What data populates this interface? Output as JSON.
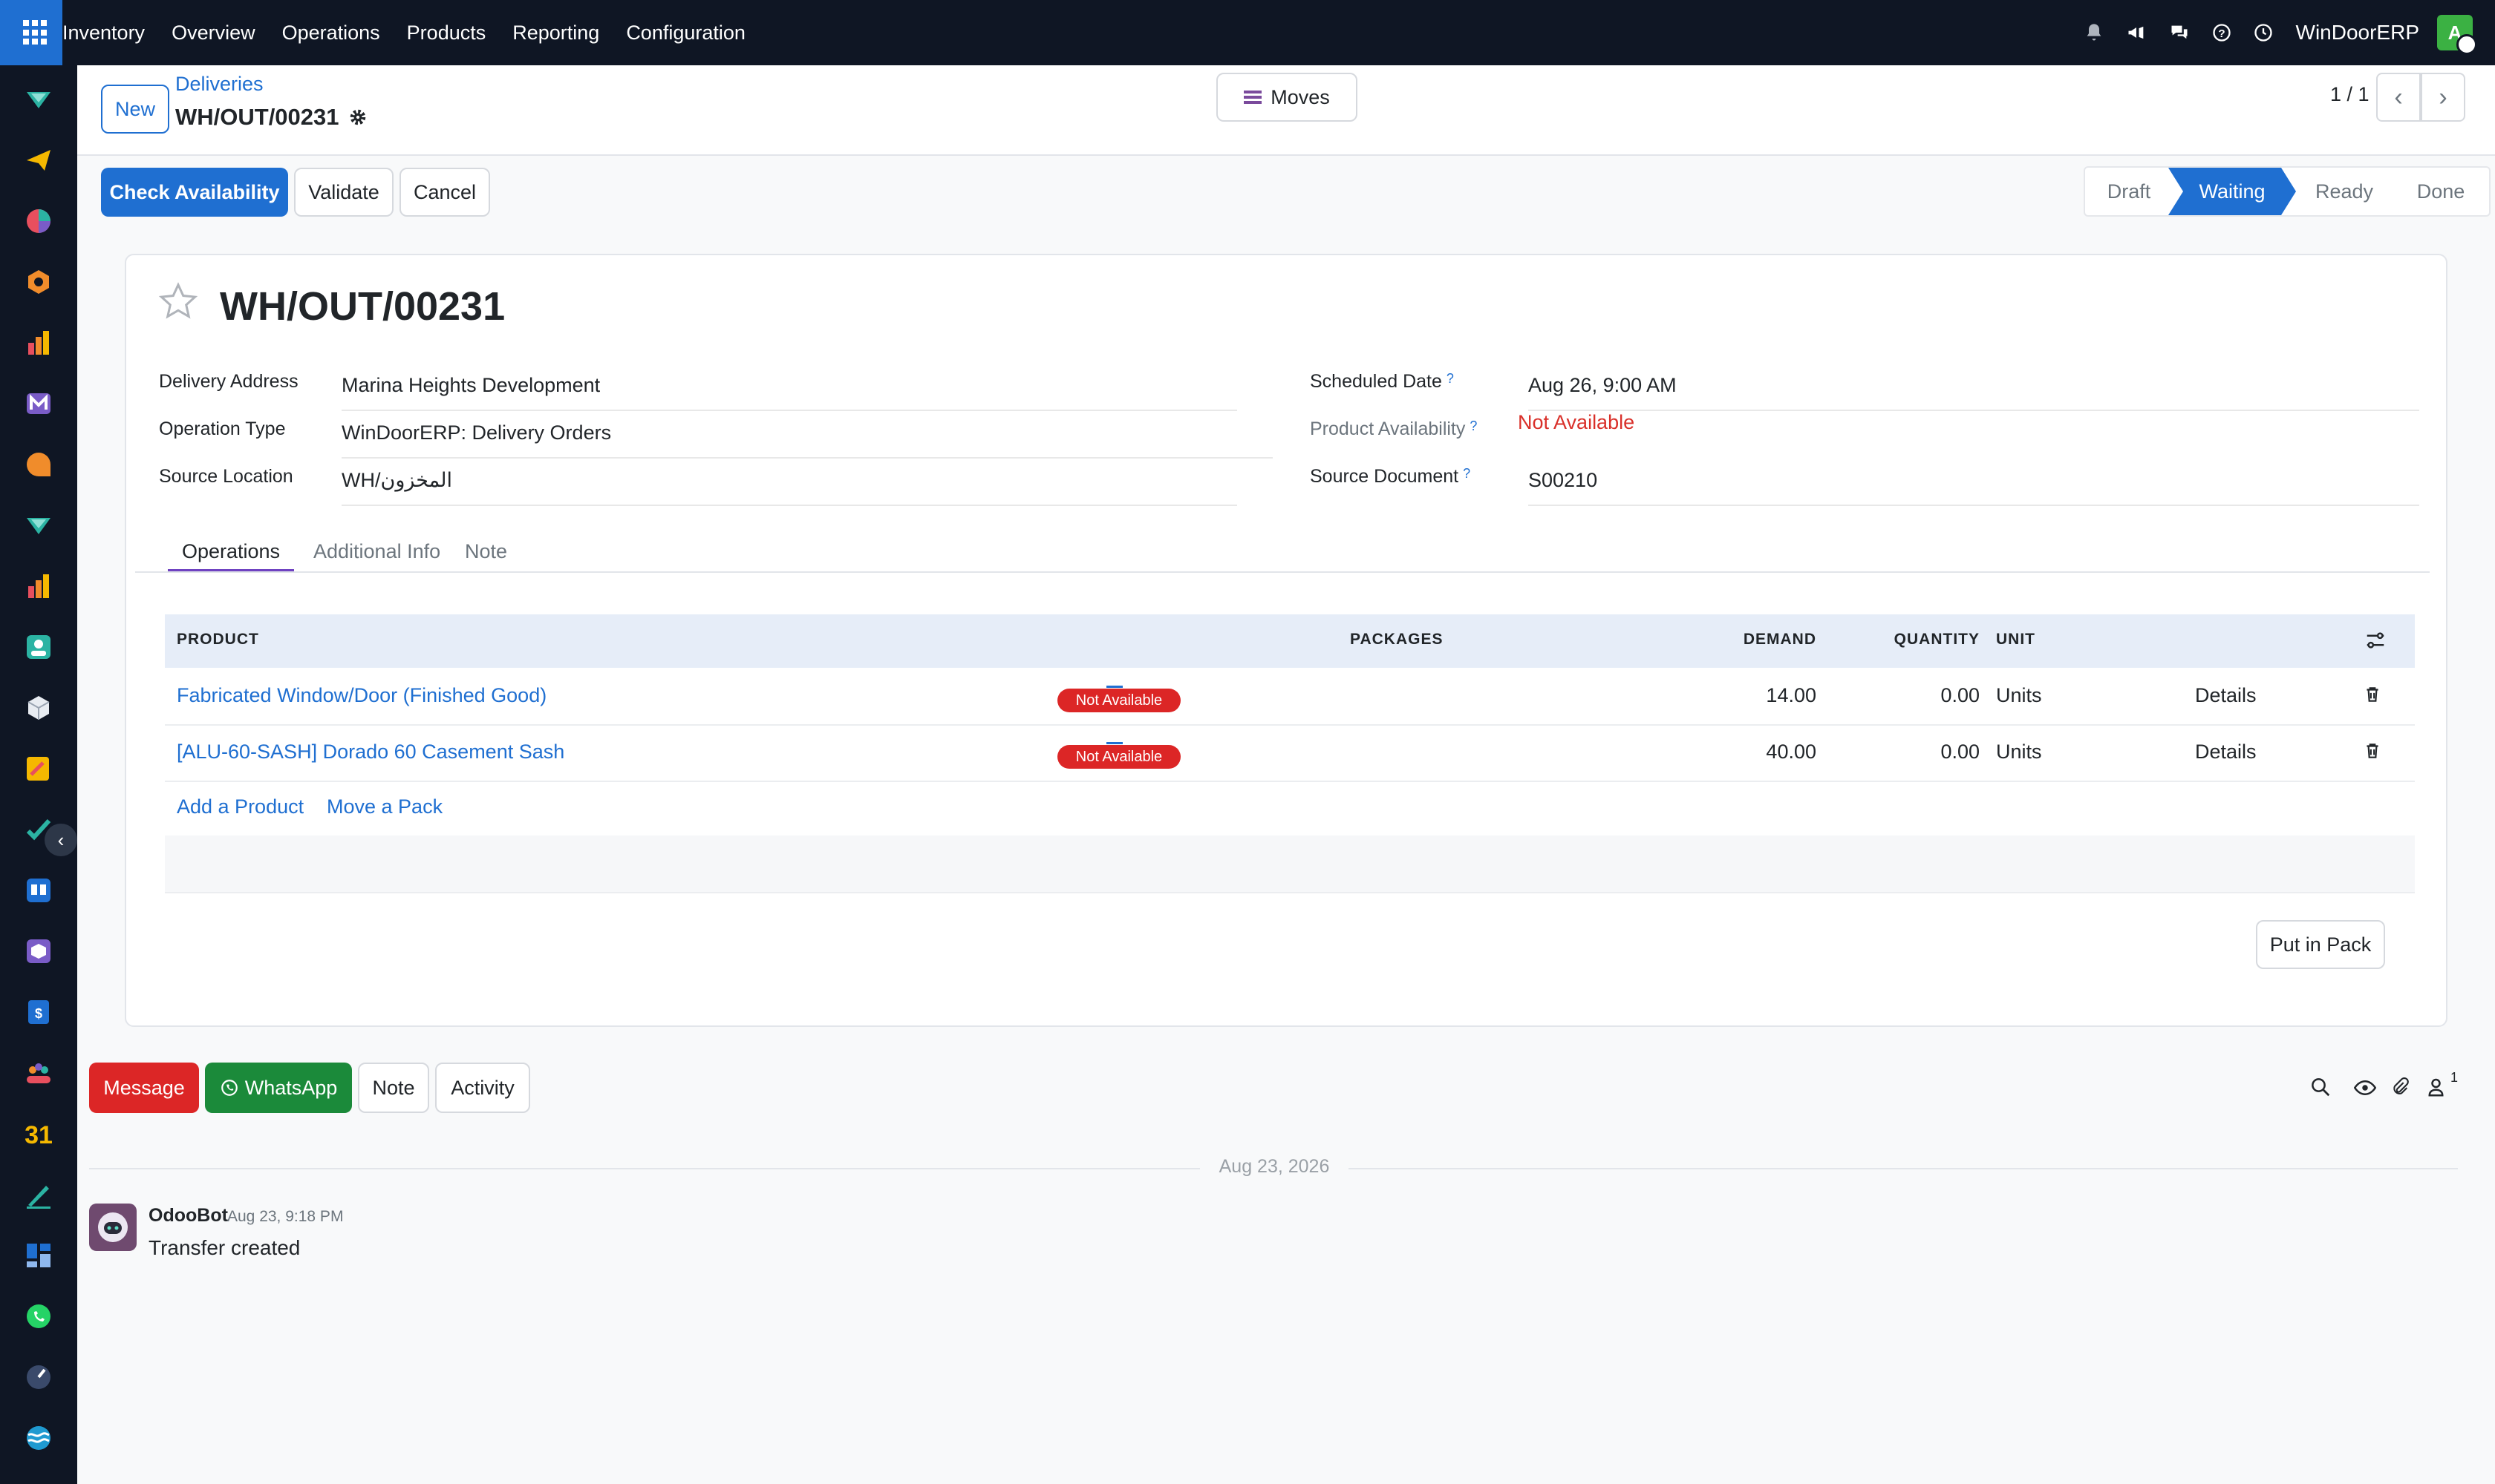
{
  "topbar": {
    "app_name": "Inventory",
    "menu": [
      "Overview",
      "Operations",
      "Products",
      "Reporting",
      "Configuration"
    ],
    "company": "WinDoorERP",
    "avatar_letter": "A"
  },
  "control_panel": {
    "new_label": "New",
    "breadcrumb": "Deliveries",
    "record_name": "WH/OUT/00231",
    "moves_label": "Moves",
    "pager": "1 / 1"
  },
  "actions": {
    "check_availability": "Check Availability",
    "validate": "Validate",
    "cancel": "Cancel"
  },
  "status_bar": {
    "steps": [
      "Draft",
      "Waiting",
      "Ready",
      "Done"
    ],
    "active": "Waiting",
    "active_color": "#1f6fd1"
  },
  "form": {
    "title": "WH/OUT/00231",
    "delivery_address_label": "Delivery Address",
    "delivery_address": "Marina Heights Development",
    "operation_type_label": "Operation Type",
    "operation_type": "WinDoorERP: Delivery Orders",
    "source_location_label": "Source Location",
    "source_location": "WH/المخزون",
    "scheduled_date_label": "Scheduled Date",
    "scheduled_date": "Aug 26, 9:00 AM",
    "product_availability_label": "Product Availability",
    "product_availability": "Not Available",
    "source_document_label": "Source Document",
    "source_document": "S00210",
    "help_mark": "?"
  },
  "tabs": [
    "Operations",
    "Additional Info",
    "Note"
  ],
  "table": {
    "headers": {
      "product": "PRODUCT",
      "packages": "PACKAGES",
      "demand": "DEMAND",
      "quantity": "QUANTITY",
      "unit": "UNIT"
    },
    "rows": [
      {
        "product": "Fabricated Window/Door (Finished Good)",
        "status": "Not Available",
        "demand": "14.00",
        "quantity": "0.00",
        "unit": "Units",
        "details": "Details"
      },
      {
        "product": "[ALU-60-SASH] Dorado 60 Casement Sash",
        "status": "Not Available",
        "demand": "40.00",
        "quantity": "0.00",
        "unit": "Units",
        "details": "Details"
      }
    ],
    "add_product": "Add a Product",
    "move_pack": "Move a Pack",
    "put_in_pack": "Put in Pack"
  },
  "chatter": {
    "message": "Message",
    "whatsapp": "WhatsApp",
    "note": "Note",
    "activity": "Activity",
    "followers_count": "1",
    "date_separator": "Aug 23, 2026",
    "author": "OdooBot",
    "time": "Aug 23, 9:18 PM",
    "body": "Transfer created"
  },
  "colors": {
    "accent": "#1f6fd1",
    "danger": "#dc2626",
    "whatsapp": "#1b8a3a",
    "topbar": "#0f1624"
  }
}
